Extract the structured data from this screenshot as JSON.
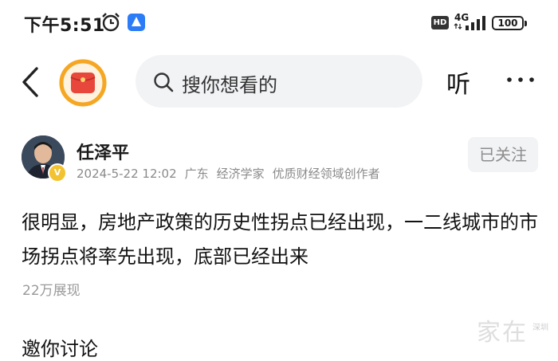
{
  "status_bar": {
    "time": "下午5:51",
    "hd": "HD",
    "network": "4G",
    "battery": "100"
  },
  "nav": {
    "search_placeholder": "搜你想看的",
    "listen_label": "听"
  },
  "author": {
    "name": "任泽平",
    "date": "2024-5-22 12:02",
    "location": "广东",
    "title": "经济学家",
    "tag": "优质财经领域创作者",
    "verified_mark": "V",
    "follow_label": "已关注"
  },
  "post": {
    "text": "很明显，房地产政策的历史性拐点已经出现，一二线城市的市场拐点将率先出现，底部已经出来",
    "views": "22万展现"
  },
  "section": {
    "discuss_title": "邀你讨论"
  },
  "watermark": {
    "main": "家在",
    "sub": "深圳"
  },
  "colors": {
    "accent_red": "#e8483c",
    "ring_orange": "#f5a623",
    "status_blue": "#2b7cf6"
  }
}
